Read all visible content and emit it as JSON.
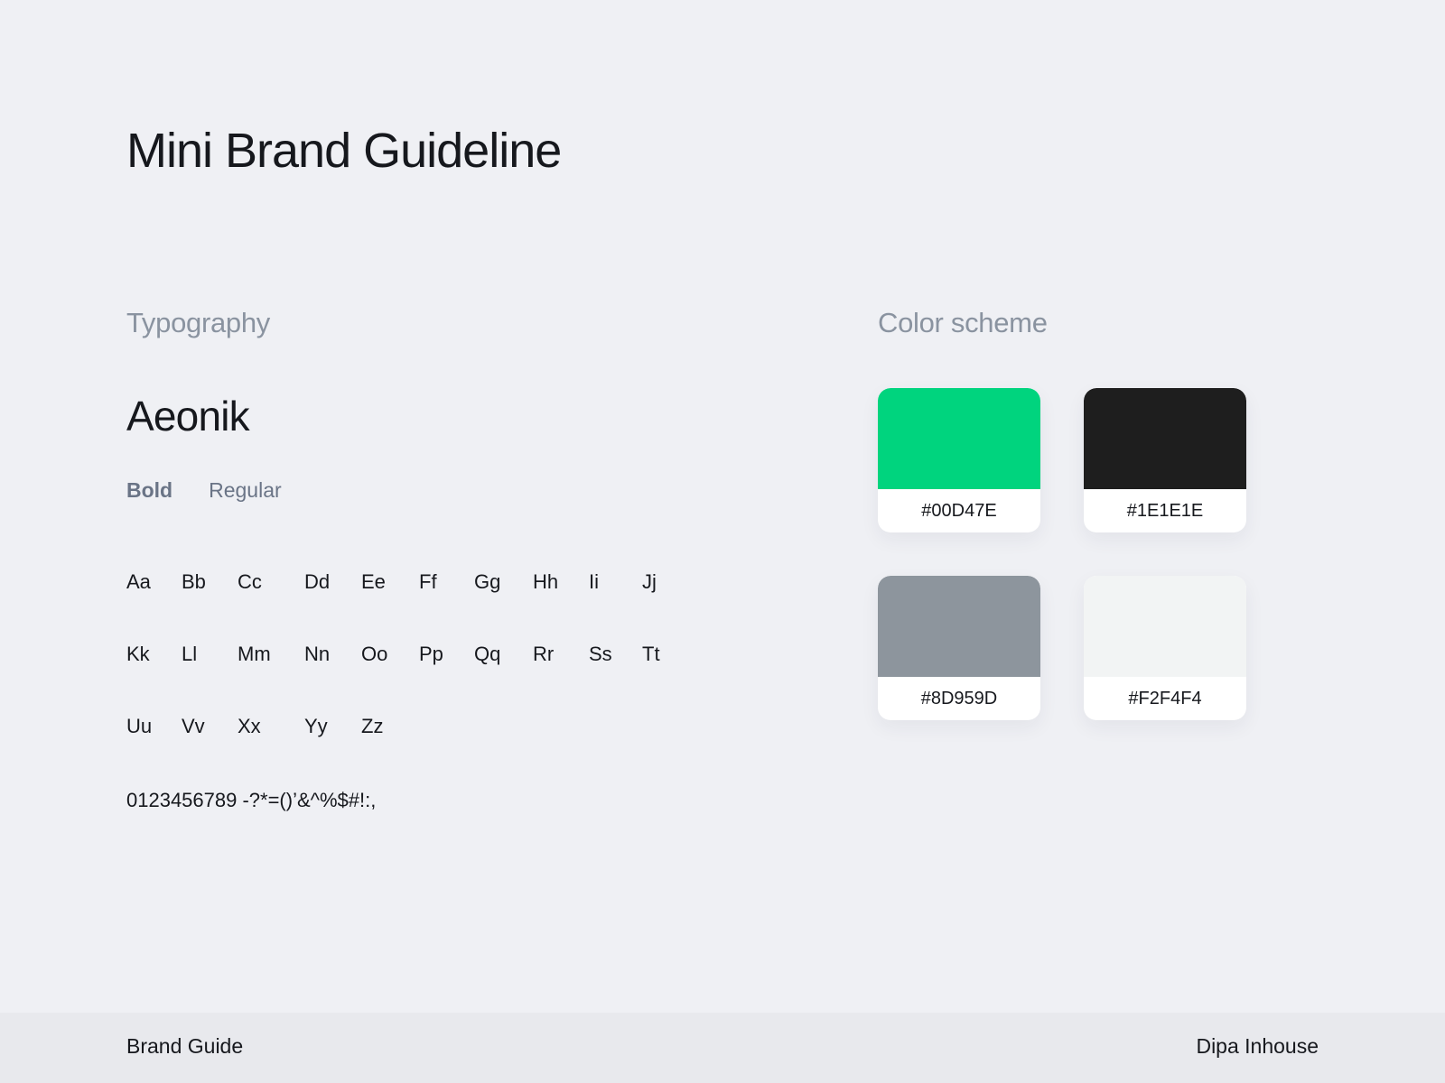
{
  "title": "Mini Brand Guideline",
  "typography": {
    "heading": "Typography",
    "font_name": "Aeonik",
    "weights": [
      "Bold",
      "Regular"
    ],
    "glyphs": [
      "Aa",
      "Bb",
      "Cc",
      "Dd",
      "Ee",
      "Ff",
      "Gg",
      "Hh",
      "Ii",
      "Jj",
      "Kk",
      "Ll",
      "Mm",
      "Nn",
      "Oo",
      "Pp",
      "Qq",
      "Rr",
      "Ss",
      "Tt",
      "Uu",
      "Vv",
      "Xx",
      "Yy",
      "Zz"
    ],
    "numerals": "0123456789 -?*=()’&^%$#!:,"
  },
  "colors": {
    "heading": "Color scheme",
    "swatches": [
      {
        "hex": "#00D47E",
        "label": "#00D47E"
      },
      {
        "hex": "#1E1E1E",
        "label": "#1E1E1E"
      },
      {
        "hex": "#8D959D",
        "label": "#8D959D"
      },
      {
        "hex": "#F2F4F4",
        "label": "#F2F4F4"
      }
    ]
  },
  "footer": {
    "left": "Brand Guide",
    "right": "Dipa Inhouse"
  }
}
